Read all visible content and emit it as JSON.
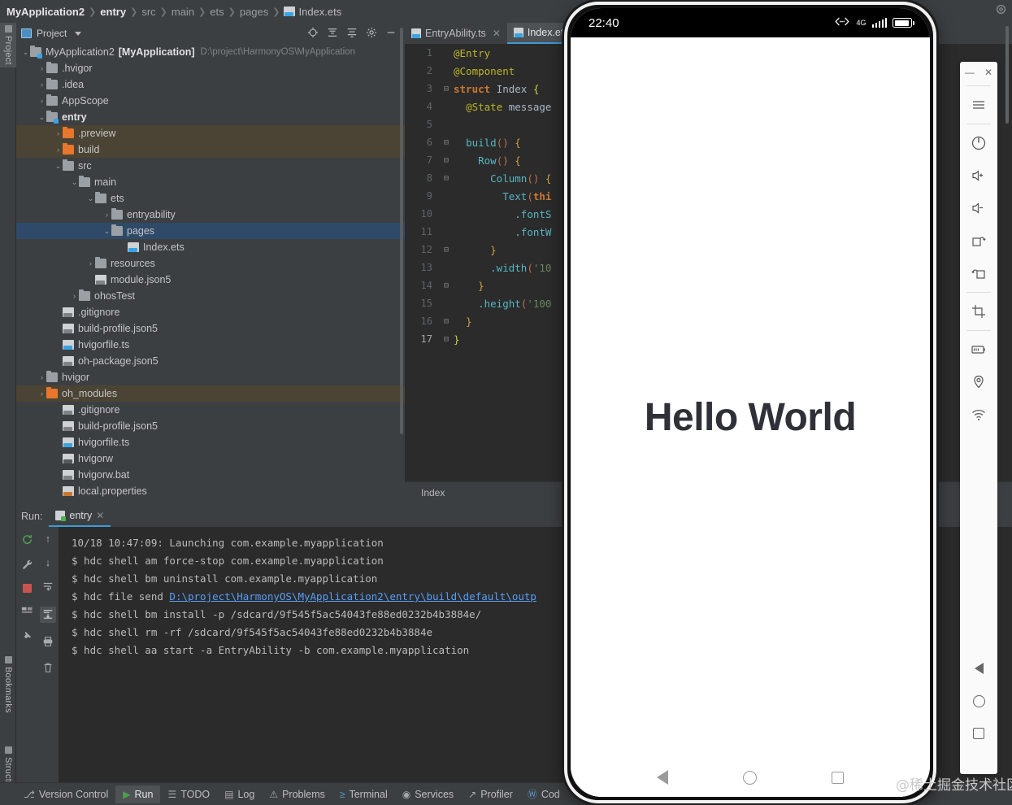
{
  "window": {
    "breadcrumb": [
      "MyApplication2",
      "entry",
      "src",
      "main",
      "ets",
      "pages",
      "Index.ets"
    ],
    "settings_icon": "gear-icon"
  },
  "left_strip": {
    "tabs": [
      {
        "label": "Project",
        "icon": "project-icon",
        "active": true
      },
      {
        "label": "Bookmarks",
        "icon": "bookmarks-icon",
        "active": false
      },
      {
        "label": "Structure",
        "icon": "structure-icon",
        "active": false
      }
    ]
  },
  "project_panel": {
    "title": "Project",
    "tools": [
      {
        "name": "locate-icon",
        "glyph": "⊕"
      },
      {
        "name": "expand-all-icon",
        "glyph": "≡"
      },
      {
        "name": "collapse-all-icon",
        "glyph": "≢"
      },
      {
        "name": "settings-gear-icon",
        "glyph": "⚙"
      },
      {
        "name": "hide-panel-icon",
        "glyph": "—"
      }
    ],
    "tree": [
      {
        "indent": 0,
        "arrow": "⌄",
        "icon": "folder-module",
        "label": "MyApplication2",
        "bold_suffix": "[MyApplication]",
        "path": "D:\\project\\HarmonyOS\\MyApplication",
        "state": "normal"
      },
      {
        "indent": 1,
        "arrow": "›",
        "icon": "folder",
        "label": ".hvigor",
        "state": "normal"
      },
      {
        "indent": 1,
        "arrow": "›",
        "icon": "folder",
        "label": ".idea",
        "state": "normal"
      },
      {
        "indent": 1,
        "arrow": "›",
        "icon": "folder",
        "label": "AppScope",
        "state": "normal"
      },
      {
        "indent": 1,
        "arrow": "⌄",
        "icon": "folder-module",
        "label": "entry",
        "bold": true,
        "state": "normal"
      },
      {
        "indent": 2,
        "arrow": "›",
        "icon": "folder-orange",
        "label": ".preview",
        "state": "highlight"
      },
      {
        "indent": 2,
        "arrow": "›",
        "icon": "folder-orange",
        "label": "build",
        "state": "highlight"
      },
      {
        "indent": 2,
        "arrow": "⌄",
        "icon": "folder",
        "label": "src",
        "state": "normal"
      },
      {
        "indent": 3,
        "arrow": "⌄",
        "icon": "folder",
        "label": "main",
        "state": "normal"
      },
      {
        "indent": 4,
        "arrow": "⌄",
        "icon": "folder",
        "label": "ets",
        "state": "normal"
      },
      {
        "indent": 5,
        "arrow": "›",
        "icon": "folder",
        "label": "entryability",
        "state": "normal"
      },
      {
        "indent": 5,
        "arrow": "⌄",
        "icon": "folder",
        "label": "pages",
        "state": "selected"
      },
      {
        "indent": 6,
        "arrow": "",
        "icon": "file-ets",
        "label": "Index.ets",
        "state": "normal"
      },
      {
        "indent": 4,
        "arrow": "›",
        "icon": "folder",
        "label": "resources",
        "state": "normal"
      },
      {
        "indent": 4,
        "arrow": "",
        "icon": "file-json5",
        "label": "module.json5",
        "state": "normal"
      },
      {
        "indent": 3,
        "arrow": "›",
        "icon": "folder",
        "label": "ohosTest",
        "state": "normal"
      },
      {
        "indent": 2,
        "arrow": "",
        "icon": "file-json5",
        "label": ".gitignore",
        "state": "normal"
      },
      {
        "indent": 2,
        "arrow": "",
        "icon": "file-json5",
        "label": "build-profile.json5",
        "state": "normal"
      },
      {
        "indent": 2,
        "arrow": "",
        "icon": "file-ts",
        "label": "hvigorfile.ts",
        "state": "normal"
      },
      {
        "indent": 2,
        "arrow": "",
        "icon": "file-json5",
        "label": "oh-package.json5",
        "state": "normal"
      },
      {
        "indent": 1,
        "arrow": "›",
        "icon": "folder",
        "label": "hvigor",
        "state": "normal"
      },
      {
        "indent": 1,
        "arrow": "›",
        "icon": "folder-orange",
        "label": "oh_modules",
        "state": "highlight"
      },
      {
        "indent": 2,
        "arrow": "",
        "icon": "file-json5",
        "label": ".gitignore",
        "state": "normal"
      },
      {
        "indent": 2,
        "arrow": "",
        "icon": "file-json5",
        "label": "build-profile.json5",
        "state": "normal"
      },
      {
        "indent": 2,
        "arrow": "",
        "icon": "file-ts",
        "label": "hvigorfile.ts",
        "state": "normal"
      },
      {
        "indent": 2,
        "arrow": "",
        "icon": "file-play",
        "label": "hvigorw",
        "state": "normal"
      },
      {
        "indent": 2,
        "arrow": "",
        "icon": "file-bat",
        "label": "hvigorw.bat",
        "state": "normal"
      },
      {
        "indent": 2,
        "arrow": "",
        "icon": "file-props",
        "label": "local.properties",
        "state": "normal"
      }
    ]
  },
  "editor": {
    "tabs": [
      {
        "label": "EntryAbility.ts",
        "active": false,
        "closable": true
      },
      {
        "label": "Index.ets",
        "active": true,
        "closable": true
      }
    ],
    "breadcrumb_footer": "Index",
    "lines": [
      {
        "n": "1",
        "fold": "",
        "segments": [
          {
            "t": "@Entry",
            "c": "dec"
          }
        ]
      },
      {
        "n": "2",
        "fold": "",
        "segments": [
          {
            "t": "@Component",
            "c": "dec"
          }
        ]
      },
      {
        "n": "3",
        "fold": "⊟",
        "segments": [
          {
            "t": "struct ",
            "c": "kwb"
          },
          {
            "t": "Index ",
            "c": "typ"
          },
          {
            "t": "{",
            "c": "br1"
          }
        ]
      },
      {
        "n": "4",
        "fold": "",
        "segments": [
          {
            "t": "  ",
            "c": "ctxt"
          },
          {
            "t": "@State",
            "c": "dec"
          },
          {
            "t": " message",
            "c": "ctxt"
          }
        ]
      },
      {
        "n": "5",
        "fold": "",
        "segments": []
      },
      {
        "n": "6",
        "fold": "⊟",
        "segments": [
          {
            "t": "  ",
            "c": "ctxt"
          },
          {
            "t": "build",
            "c": "fn"
          },
          {
            "t": "()",
            "c": "br2"
          },
          {
            "t": " ",
            "c": "ctxt"
          },
          {
            "t": "{",
            "c": "br3"
          }
        ]
      },
      {
        "n": "7",
        "fold": "⊟",
        "segments": [
          {
            "t": "    ",
            "c": "ctxt"
          },
          {
            "t": "Row",
            "c": "fn"
          },
          {
            "t": "()",
            "c": "br2"
          },
          {
            "t": " ",
            "c": "ctxt"
          },
          {
            "t": "{",
            "c": "br3"
          }
        ]
      },
      {
        "n": "8",
        "fold": "⊟",
        "segments": [
          {
            "t": "      ",
            "c": "ctxt"
          },
          {
            "t": "Column",
            "c": "fn"
          },
          {
            "t": "()",
            "c": "br2"
          },
          {
            "t": " ",
            "c": "ctxt"
          },
          {
            "t": "{",
            "c": "br3"
          }
        ]
      },
      {
        "n": "9",
        "fold": "",
        "segments": [
          {
            "t": "        ",
            "c": "ctxt"
          },
          {
            "t": "Text",
            "c": "fn"
          },
          {
            "t": "(",
            "c": "br2"
          },
          {
            "t": "thi",
            "c": "kwb"
          }
        ]
      },
      {
        "n": "10",
        "fold": "",
        "segments": [
          {
            "t": "          ",
            "c": "ctxt"
          },
          {
            "t": ".fontS",
            "c": "fn"
          }
        ]
      },
      {
        "n": "11",
        "fold": "",
        "segments": [
          {
            "t": "          ",
            "c": "ctxt"
          },
          {
            "t": ".fontW",
            "c": "fn"
          }
        ]
      },
      {
        "n": "12",
        "fold": "⊟",
        "segments": [
          {
            "t": "      ",
            "c": "ctxt"
          },
          {
            "t": "}",
            "c": "br3"
          }
        ]
      },
      {
        "n": "13",
        "fold": "",
        "segments": [
          {
            "t": "      ",
            "c": "ctxt"
          },
          {
            "t": ".width",
            "c": "fn"
          },
          {
            "t": "(",
            "c": "br2"
          },
          {
            "t": "'10",
            "c": "str"
          }
        ]
      },
      {
        "n": "14",
        "fold": "⊟",
        "segments": [
          {
            "t": "    ",
            "c": "ctxt"
          },
          {
            "t": "}",
            "c": "br3"
          }
        ]
      },
      {
        "n": "15",
        "fold": "",
        "segments": [
          {
            "t": "    ",
            "c": "ctxt"
          },
          {
            "t": ".height",
            "c": "fn"
          },
          {
            "t": "(",
            "c": "br2"
          },
          {
            "t": "'100",
            "c": "str"
          }
        ]
      },
      {
        "n": "16",
        "fold": "⊟",
        "segments": [
          {
            "t": "  ",
            "c": "ctxt"
          },
          {
            "t": "}",
            "c": "br3"
          }
        ]
      },
      {
        "n": "17",
        "fold": "⊟",
        "segments": [
          {
            "t": "}",
            "c": "br1"
          }
        ],
        "current": true
      }
    ]
  },
  "run_panel": {
    "label": "Run:",
    "tab_label": "entry",
    "tools_left": [
      {
        "name": "rerun-icon",
        "glyph": "↻"
      },
      {
        "name": "wrench-icon",
        "glyph": "⚒"
      },
      {
        "name": "stop-icon",
        "glyph": "■"
      },
      {
        "name": "layout-icon",
        "glyph": "▤"
      },
      {
        "name": "pin-icon",
        "glyph": "✒"
      }
    ],
    "tools_right": [
      {
        "name": "scroll-up-icon",
        "glyph": "↑"
      },
      {
        "name": "scroll-down-icon",
        "glyph": "↓"
      },
      {
        "name": "soft-wrap-icon",
        "glyph": "↵"
      },
      {
        "name": "scroll-to-end-icon",
        "glyph": "↧"
      },
      {
        "name": "print-icon",
        "glyph": "⎙"
      },
      {
        "name": "clear-all-icon",
        "glyph": "Ὕ1"
      }
    ],
    "console": [
      {
        "text": "10/18 10:47:09: Launching com.example.myapplication"
      },
      {
        "text": "$ hdc shell am force-stop com.example.myapplication"
      },
      {
        "text": "$ hdc shell bm uninstall com.example.myapplication"
      },
      {
        "text": "$ hdc file send ",
        "link": "D:\\project\\HarmonyOS\\MyApplication2\\entry\\build\\default\\outp"
      },
      {
        "text": "$ hdc shell bm install -p /sdcard/9f545f5ac54043fe88ed0232b4b3884e/"
      },
      {
        "text": "$ hdc shell rm -rf /sdcard/9f545f5ac54043fe88ed0232b4b3884e"
      },
      {
        "text": "$ hdc shell aa start -a EntryAbility -b com.example.myapplication"
      }
    ]
  },
  "status_bar": {
    "items": [
      {
        "label": "Version Control",
        "icon": "branch-icon",
        "glyph": "⎇",
        "active": false
      },
      {
        "label": "Run",
        "icon": "run-triangle-icon",
        "glyph": "▶",
        "active": true
      },
      {
        "label": "TODO",
        "icon": "todo-list-icon",
        "glyph": "☰",
        "active": false
      },
      {
        "label": "Log",
        "icon": "log-icon",
        "glyph": "▤",
        "active": false
      },
      {
        "label": "Problems",
        "icon": "problems-icon",
        "glyph": "⚠",
        "active": false
      },
      {
        "label": "Terminal",
        "icon": "terminal-icon",
        "glyph": "≥",
        "active": false
      },
      {
        "label": "Services",
        "icon": "services-icon",
        "glyph": "◉",
        "active": false
      },
      {
        "label": "Profiler",
        "icon": "profiler-icon",
        "glyph": "↗",
        "active": false
      },
      {
        "label": "Cod",
        "icon": "code-linter-icon",
        "glyph": "Ⓦ",
        "active": false
      }
    ]
  },
  "emulator": {
    "status": {
      "time": "22:40",
      "network_icon": "network-arrows-icon",
      "network_type": "4G",
      "signal_icon": "signal-bars-icon",
      "battery_icon": "battery-icon"
    },
    "app": {
      "hello_text": "Hello World"
    },
    "nav": [
      {
        "name": "nav-back-button",
        "icon": "triangle-back-icon"
      },
      {
        "name": "nav-home-button",
        "icon": "circle-home-icon"
      },
      {
        "name": "nav-recents-button",
        "icon": "square-recents-icon"
      }
    ],
    "watermark": "@稀土掘金技术社区",
    "toolbar": {
      "window_controls": [
        {
          "name": "minimize-button",
          "glyph": "—"
        },
        {
          "name": "close-button",
          "glyph": "✕"
        }
      ],
      "buttons": [
        {
          "name": "menu-button",
          "glyph": "≡"
        },
        {
          "name": "power-button",
          "glyph": "⏻"
        },
        {
          "name": "volume-up-button",
          "glyph": "🔊"
        },
        {
          "name": "volume-down-button",
          "glyph": "🔉"
        },
        {
          "name": "rotate-right-button",
          "glyph": "↻"
        },
        {
          "name": "rotate-left-button",
          "glyph": "↺"
        },
        {
          "name": "screenshot-button",
          "glyph": "⌘"
        },
        {
          "name": "battery-settings-button",
          "glyph": "▭"
        },
        {
          "name": "location-button",
          "glyph": "◎"
        },
        {
          "name": "wifi-button",
          "glyph": "◠"
        }
      ]
    }
  }
}
